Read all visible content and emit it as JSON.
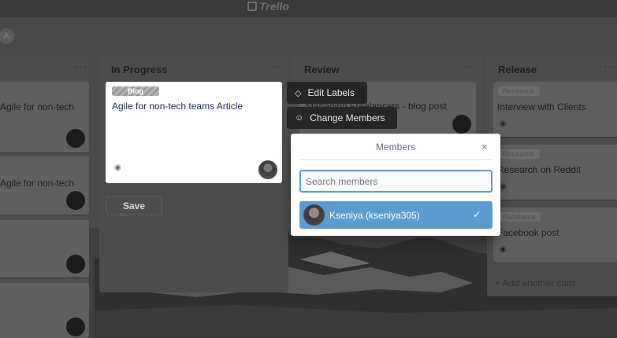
{
  "header": {
    "logo_text": "Trello",
    "board_avatar_initial": "A"
  },
  "lists": [
    {
      "title": "",
      "cards": [
        {
          "title": "Agile for non-tech"
        },
        {
          "title": "Agile for non-tech"
        },
        {
          "title": ""
        },
        {
          "title": ""
        }
      ]
    },
    {
      "title": "In Progress",
      "editing_card": {
        "label": "Blog",
        "title": "Agile for non-tech teams Article",
        "save_label": "Save"
      }
    },
    {
      "title": "Review",
      "cards": [
        {
          "title": "Managing Freelancers - blog post"
        }
      ]
    },
    {
      "title": "Release",
      "cards": [
        {
          "label": "Research",
          "title": "Interview with Clients"
        },
        {
          "label": "Research",
          "title": "Research on Reddit"
        },
        {
          "label": "Facebook",
          "title": "Facebook post"
        }
      ],
      "add_card_label": "+ Add another card"
    }
  ],
  "list_menu": "···",
  "quick_edit": {
    "edit_labels": "Edit Labels",
    "change_members": "Change Members"
  },
  "members_popover": {
    "title": "Members",
    "close": "×",
    "search_placeholder": "Search members",
    "members": [
      {
        "name": "Kseniya (kseniya305)",
        "selected": true
      }
    ]
  },
  "colors": {
    "accent": "#5b9bd0",
    "quick_button_bg": "#262626",
    "card_bg": "#ffffff"
  },
  "icons": {
    "edit_labels": "tag-icon",
    "change_members": "person-icon",
    "watch": "eye-icon",
    "selected": "check-icon",
    "close": "close-icon"
  }
}
